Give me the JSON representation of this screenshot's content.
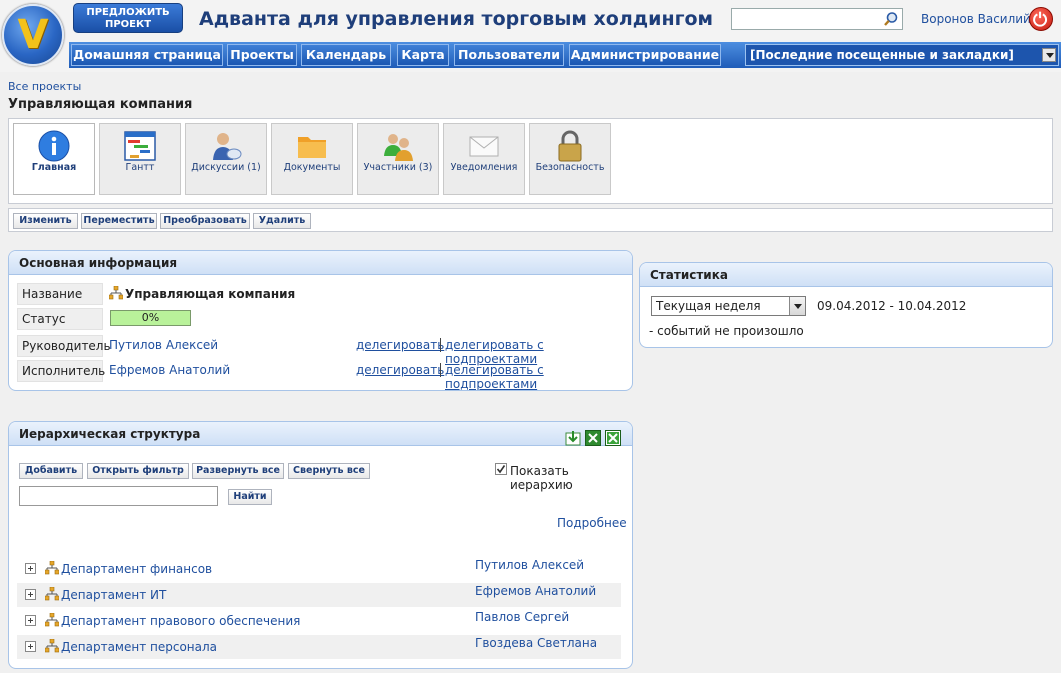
{
  "header": {
    "suggest_button": "ПРЕДЛОЖИТЬ ПРОЕКТ",
    "app_title": "Адванта для управления торговым холдингом",
    "search_value": "",
    "user_name": "Воронов Василий"
  },
  "nav": {
    "items": [
      "Домашняя страница",
      "Проекты",
      "Календарь",
      "Карта",
      "Пользователи",
      "Администрирование"
    ],
    "dropdown": "[Последние посещенные и закладки]"
  },
  "breadcrumb": "Все проекты",
  "page_title": "Управляющая компания",
  "tabs": [
    {
      "label": "Главная",
      "icon": "info-icon",
      "active": true
    },
    {
      "label": "Гантт",
      "icon": "gantt-icon",
      "active": false
    },
    {
      "label": "Дискуссии (1)",
      "icon": "discussion-icon",
      "active": false
    },
    {
      "label": "Документы",
      "icon": "folder-icon",
      "active": false
    },
    {
      "label": "Участники (3)",
      "icon": "users-icon",
      "active": false
    },
    {
      "label": "Уведомления",
      "icon": "envelope-icon",
      "active": false
    },
    {
      "label": "Безопасность",
      "icon": "lock-icon",
      "active": false
    }
  ],
  "actions": [
    "Изменить",
    "Переместить",
    "Преобразовать",
    "Удалить"
  ],
  "main_info": {
    "title": "Основная информация",
    "name_label": "Название",
    "name_value": "Управляющая компания",
    "status_label": "Статус",
    "status_value": "0%",
    "status_progress": 0,
    "manager_label": "Руководитель",
    "manager_value": "Путилов Алексей",
    "executor_label": "Исполнитель",
    "executor_value": "Ефремов Анатолий",
    "delegate": "делегировать",
    "delegate_sub": "делегировать с подпроектами"
  },
  "stats": {
    "title": "Статистика",
    "period_selected": "Текущая неделя",
    "date_range": "09.04.2012 - 10.04.2012",
    "no_events": "- событий не произошло"
  },
  "hierarchy": {
    "title": "Иерархическая структура",
    "buttons": [
      "Добавить",
      "Открыть фильтр",
      "Развернуть все",
      "Свернуть все"
    ],
    "show_hierarchy_label": "Показать иерархию",
    "show_hierarchy_checked": true,
    "find_button": "Найти",
    "search_value": "",
    "more_link": "Подробнее",
    "rows": [
      {
        "name": "Департамент финансов",
        "owner": "Путилов Алексей"
      },
      {
        "name": "Департамент ИТ",
        "owner": "Ефремов Анатолий"
      },
      {
        "name": "Департамент правового обеспечения",
        "owner": "Павлов Сергей"
      },
      {
        "name": "Департамент персонала",
        "owner": "Гвоздева Светлана"
      }
    ]
  },
  "colors": {
    "accent": "#1f5cb8",
    "link": "#1f4f9e",
    "progress": "#b9f29a"
  }
}
